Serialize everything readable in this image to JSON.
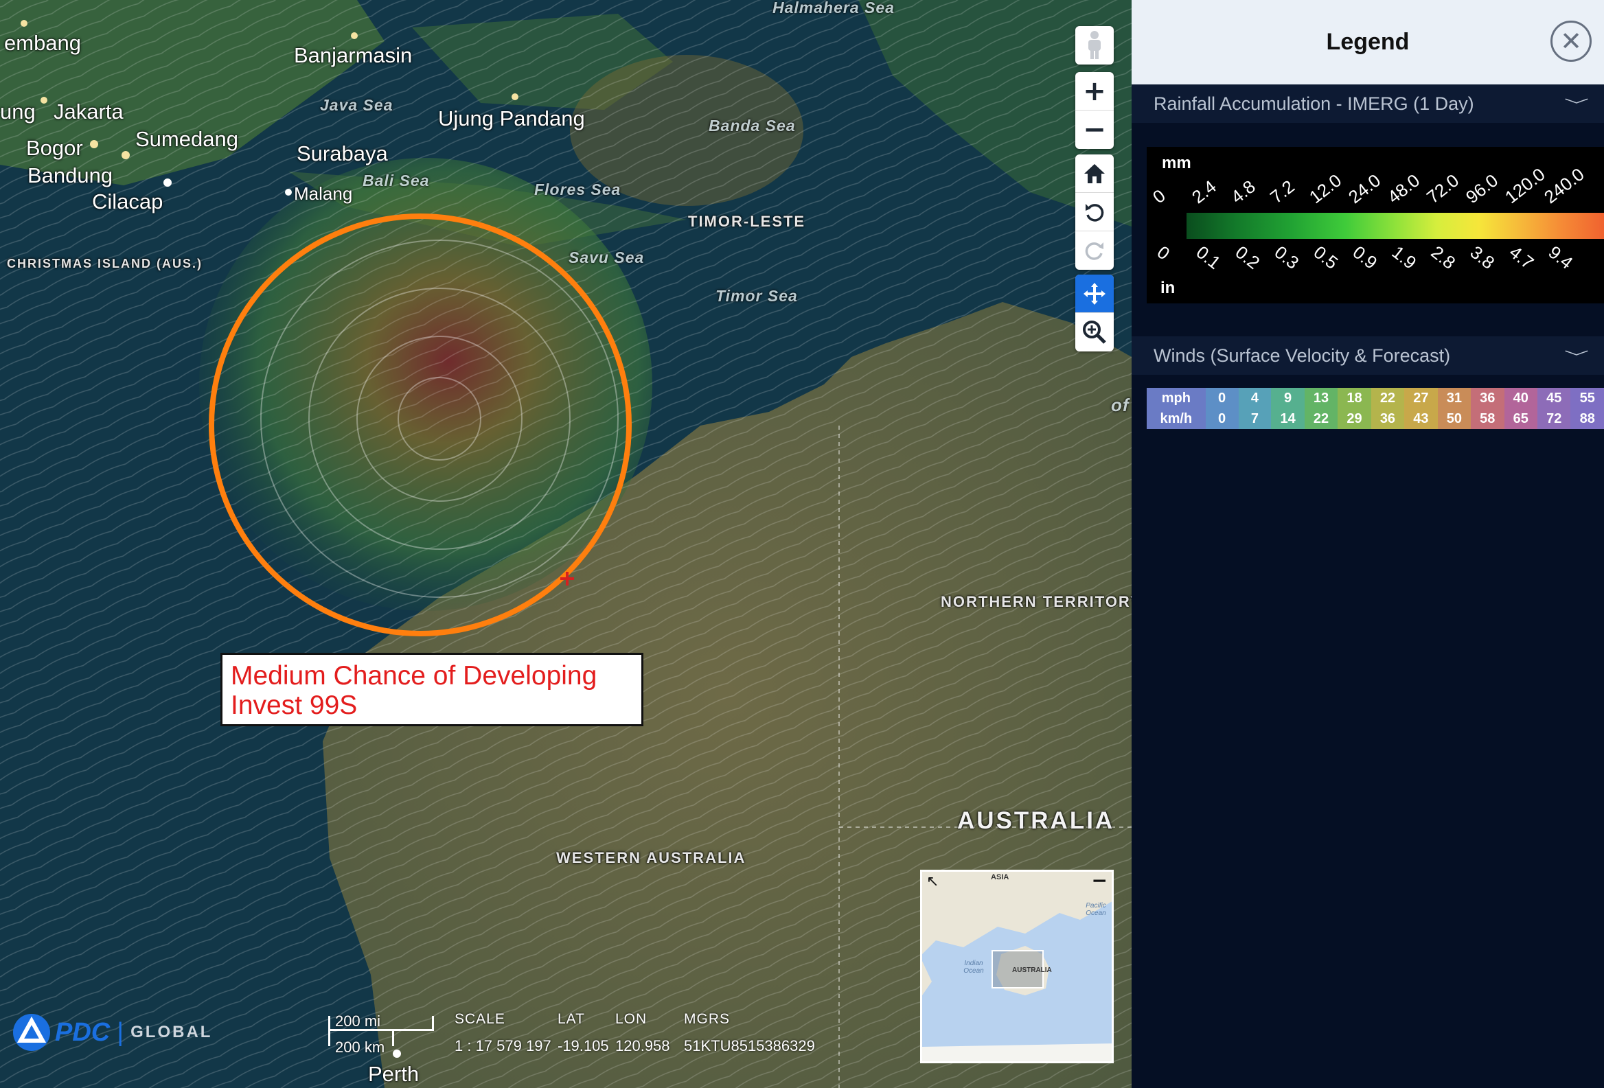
{
  "map": {
    "cities": [
      {
        "name": "embang"
      },
      {
        "name": "Banjarmasin"
      },
      {
        "name": "ung"
      },
      {
        "name": "Jakarta"
      },
      {
        "name": "Sumedang"
      },
      {
        "name": "Bogor"
      },
      {
        "name": "Bandung"
      },
      {
        "name": "Cilacap"
      },
      {
        "name": "Surabaya"
      },
      {
        "name": "Malang"
      },
      {
        "name": "Ujung Pandang"
      },
      {
        "name": "Perth"
      }
    ],
    "seas": [
      "Halmahera Sea",
      "Java Sea",
      "Banda Sea",
      "Bali Sea",
      "Flores Sea",
      "Savu Sea",
      "Timor Sea"
    ],
    "regions": {
      "christmas_island": "CHRISTMAS ISLAND (AUS.)",
      "timor_leste": "TIMOR-LESTE",
      "northern_territory": "NORTHERN TERRITORY",
      "western_australia": "WESTERN AUSTRALIA",
      "australia": "AUSTRALIA",
      "gulf_fragment": "of"
    },
    "annotation": {
      "line1": "Medium Chance of Developing",
      "line2": "Invest 99S"
    },
    "colors": {
      "circle": "#ff7f0e",
      "annotation_text": "#e31d1d",
      "active_tool": "#1a6fe0"
    },
    "controls": {
      "street_view_icon": "pegman-icon",
      "zoom_in": "+",
      "zoom_out": "−",
      "home_icon": "home-icon",
      "rotate_left_icon": "rotate-ccw-icon",
      "rotate_right_icon": "rotate-cw-icon",
      "pan_icon": "move-icon",
      "zoom_box_icon": "zoom-in-icon"
    },
    "brand": {
      "logo": "PDC",
      "label": "GLOBAL"
    },
    "scale_bar": {
      "miles": "200 mi",
      "km": "200 km"
    },
    "readout": {
      "scale_label": "SCALE",
      "scale_value": "1 : 17 579 197",
      "lat_label": "LAT",
      "lat_value": "-19.105",
      "lon_label": "LON",
      "lon_value": "120.958",
      "mgrs_label": "MGRS",
      "mgrs_value": "51KTU8515386329"
    },
    "minimap": {
      "asia": "ASIA",
      "pacific": "Pacific Ocean",
      "indian": "Indian Ocean",
      "australia": "AUSTRALIA",
      "collapse": "−",
      "expand": "↖"
    }
  },
  "legend": {
    "title": "Legend",
    "close": "✕",
    "rainfall": {
      "title": "Rainfall Accumulation - IMERG (1 Day)",
      "unit_top": "mm",
      "unit_bottom": "in",
      "mm_ticks": [
        "0",
        "2.4",
        "4.8",
        "7.2",
        "12.0",
        "24.0",
        "48.0",
        "72.0",
        "96.0",
        "120.0",
        "240.0"
      ],
      "in_ticks": [
        "0",
        "0.1",
        "0.2",
        "0.3",
        "0.5",
        "0.9",
        "1.9",
        "2.8",
        "3.8",
        "4.7",
        "9.4"
      ]
    },
    "winds": {
      "title": "Winds (Surface Velocity & Forecast)",
      "mph_label": "mph",
      "kmh_label": "km/h",
      "mph": [
        "0",
        "4",
        "9",
        "13",
        "18",
        "22",
        "27",
        "31",
        "36",
        "40",
        "45",
        "55"
      ],
      "kmh": [
        "0",
        "7",
        "14",
        "22",
        "29",
        "36",
        "43",
        "50",
        "58",
        "65",
        "72",
        "88"
      ],
      "colors": [
        "#6a7bc5",
        "#5d8fc6",
        "#57a1b8",
        "#56b08f",
        "#63b466",
        "#8bb751",
        "#b4b44c",
        "#c8a84a",
        "#c98c58",
        "#c46e78",
        "#b2659a",
        "#8d6cb8",
        "#7e6fc3"
      ]
    }
  }
}
